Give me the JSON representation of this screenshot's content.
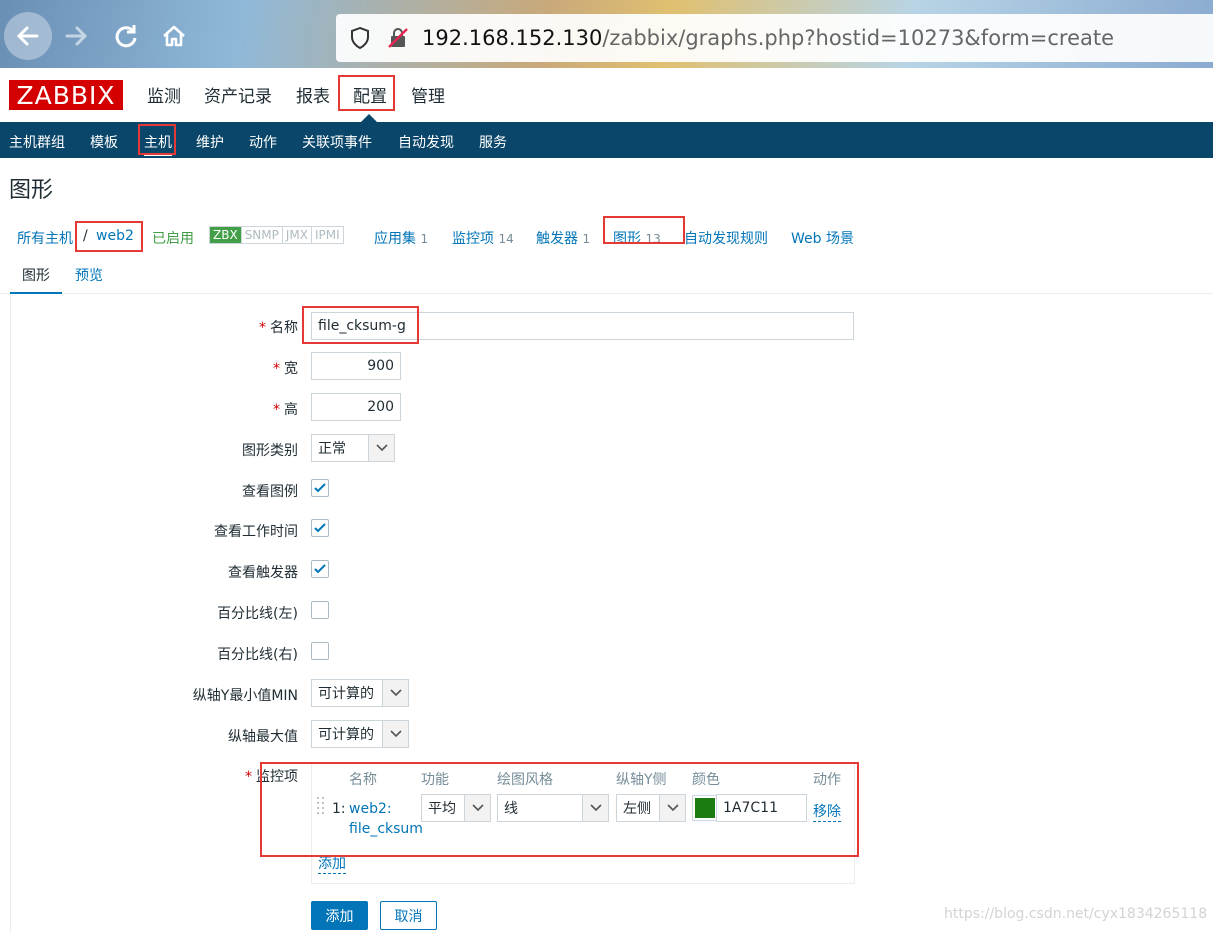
{
  "browser": {
    "url_host": "192.168.152.130",
    "url_path": "/zabbix/graphs.php?hostid=10273&form=create"
  },
  "logo": "ZABBIX",
  "top_menu": [
    "监测",
    "资产记录",
    "报表",
    "配置",
    "管理"
  ],
  "sub_menu": [
    "主机群组",
    "模板",
    "主机",
    "维护",
    "动作",
    "关联项事件",
    "自动发现",
    "服务"
  ],
  "page_title": "图形",
  "host_nav": {
    "all_hosts": "所有主机",
    "separator": "/",
    "host": "web2",
    "status": "已启用",
    "tags": [
      "ZBX",
      "SNMP",
      "JMX",
      "IPMI"
    ],
    "applications": {
      "label": "应用集",
      "count": "1"
    },
    "items": {
      "label": "监控项",
      "count": "14"
    },
    "triggers": {
      "label": "触发器",
      "count": "1"
    },
    "graphs": {
      "label": "图形",
      "count": "13"
    },
    "discovery": "自动发现规则",
    "web": "Web 场景"
  },
  "tabs": {
    "graph": "图形",
    "preview": "预览"
  },
  "form": {
    "req_mark": "*",
    "name_label": "名称",
    "name_value": "file_cksum-g",
    "width_label": "宽",
    "width_value": "900",
    "height_label": "高",
    "height_value": "200",
    "graph_type_label": "图形类别",
    "graph_type_value": "正常",
    "show_legend_label": "查看图例",
    "show_legend": true,
    "show_worktime_label": "查看工作时间",
    "show_worktime": true,
    "show_triggers_label": "查看触发器",
    "show_triggers": true,
    "percentile_left_label": "百分比线(左)",
    "percentile_left": false,
    "percentile_right_label": "百分比线(右)",
    "percentile_right": false,
    "ymin_label": "纵轴Y最小值MIN",
    "ymin_value": "可计算的",
    "ymax_label": "纵轴最大值",
    "ymax_value": "可计算的",
    "items_label": "监控项"
  },
  "items_table": {
    "headers": [
      "名称",
      "功能",
      "绘图风格",
      "纵轴Y侧",
      "颜色",
      "动作"
    ],
    "rows": [
      {
        "index": "1:",
        "name_line1": "web2:",
        "name_line2": "file_cksum",
        "function": "平均",
        "draw_style": "线",
        "y_side": "左侧",
        "color_hex": "1A7C11",
        "color_swatch": "#1a7c11",
        "action": "移除"
      }
    ],
    "add_link": "添加"
  },
  "buttons": {
    "add": "添加",
    "cancel": "取消"
  },
  "watermark": "https://blog.csdn.net/cyx1834265118",
  "colors": {
    "accent": "#0275b8",
    "nav_bg": "#0a466a",
    "logo_bg": "#d40000",
    "highlight_box": "#e53935",
    "enabled": "#429e47"
  }
}
